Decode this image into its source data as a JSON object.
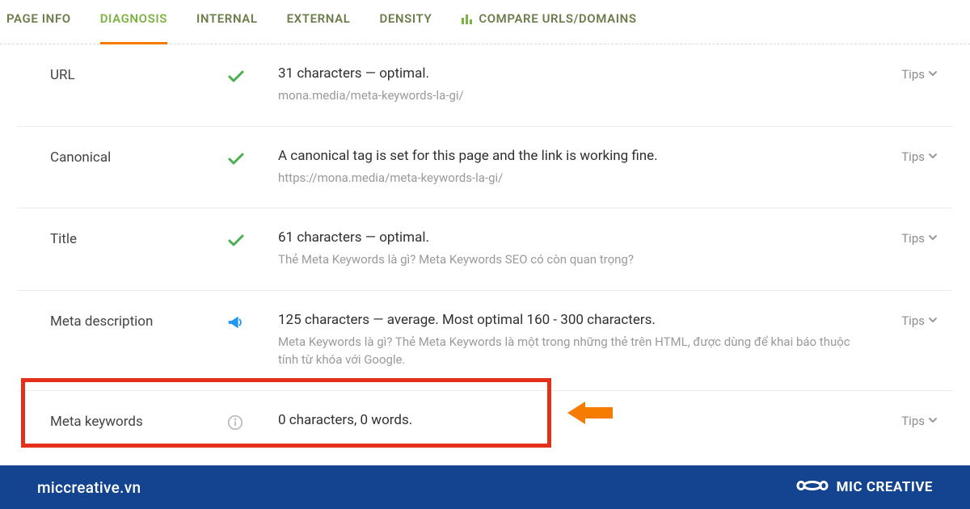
{
  "tabs": {
    "page_info": "PAGE INFO",
    "diagnosis": "DIAGNOSIS",
    "internal": "INTERNAL",
    "external": "EXTERNAL",
    "density": "DENSITY",
    "compare": "COMPARE URLS/DOMAINS"
  },
  "tips_label": "Tips",
  "rows": {
    "url": {
      "label": "URL",
      "main": "31 characters — optimal.",
      "sub": "mona.media/meta-keywords-la-gi/"
    },
    "canonical": {
      "label": "Canonical",
      "main": "A canonical tag is set for this page and the link is working fine.",
      "sub": "https://mona.media/meta-keywords-la-gi/"
    },
    "title": {
      "label": "Title",
      "main": "61 characters — optimal.",
      "sub": "Thẻ Meta Keywords là gì? Meta Keywords SEO có còn quan trọng?"
    },
    "meta_description": {
      "label": "Meta description",
      "main": "125 characters — average. Most optimal 160 - 300 characters.",
      "sub": "Meta Keywords là gì? Thẻ Meta Keywords là một trong những thẻ trên HTML, được dùng để khai báo thuộc tính từ khóa với Google."
    },
    "meta_keywords": {
      "label": "Meta keywords",
      "main": "0 characters, 0 words.",
      "sub": ""
    }
  },
  "footer": {
    "domain": "miccreative.vn",
    "brand": "MIC CREATIVE"
  },
  "colors": {
    "tab_active": "#7bb342",
    "tab_underline": "#f57c00",
    "check": "#4caf50",
    "megaphone": "#2196f3",
    "info": "#bdbdbd",
    "highlight": "#e3301a",
    "arrow": "#f57c00",
    "footer_bg": "#14438f"
  }
}
